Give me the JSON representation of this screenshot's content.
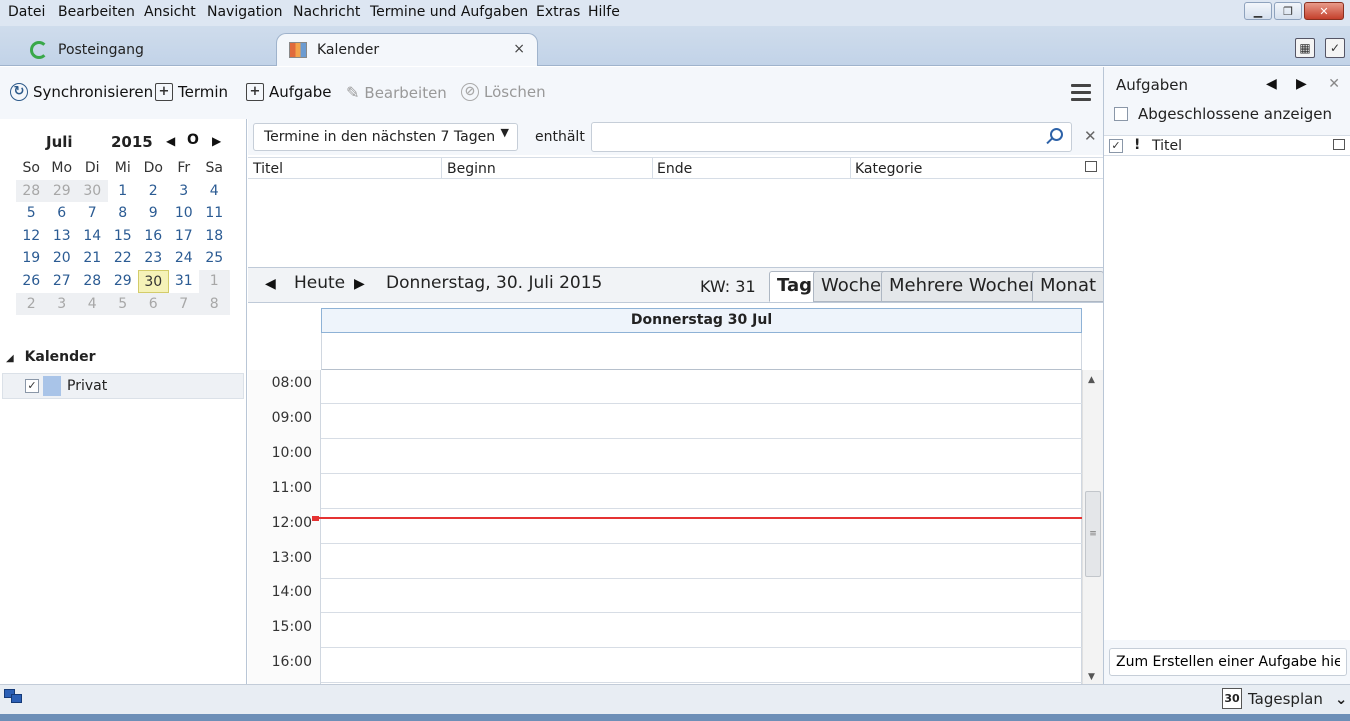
{
  "menu": [
    "Datei",
    "Bearbeiten",
    "Ansicht",
    "Navigation",
    "Nachricht",
    "Termine und Aufgaben",
    "Extras",
    "Hilfe"
  ],
  "tabs": {
    "inbox": "Posteingang",
    "calendar": "Kalender",
    "close": "×"
  },
  "toolbar": {
    "sync": "Synchronisieren",
    "event": "Termin",
    "task": "Aufgabe",
    "edit": "Bearbeiten",
    "delete": "Löschen"
  },
  "minical": {
    "month": "Juli",
    "year": "2015",
    "dow": [
      "So",
      "Mo",
      "Di",
      "Mi",
      "Do",
      "Fr",
      "Sa"
    ],
    "weeks": [
      [
        "28",
        "29",
        "30",
        "1",
        "2",
        "3",
        "4"
      ],
      [
        "5",
        "6",
        "7",
        "8",
        "9",
        "10",
        "11"
      ],
      [
        "12",
        "13",
        "14",
        "15",
        "16",
        "17",
        "18"
      ],
      [
        "19",
        "20",
        "21",
        "22",
        "23",
        "24",
        "25"
      ],
      [
        "26",
        "27",
        "28",
        "29",
        "30",
        "31",
        "1"
      ],
      [
        "2",
        "3",
        "4",
        "5",
        "6",
        "7",
        "8"
      ]
    ],
    "today": "30"
  },
  "calendars": {
    "title": "Kalender",
    "items": [
      {
        "name": "Privat",
        "color": "#a9c4e8",
        "checked": true
      }
    ]
  },
  "filter": {
    "selected": "Termine in den nächsten 7 Tagen",
    "contains": "enthält",
    "search_value": ""
  },
  "list": {
    "columns": [
      "Titel",
      "Beginn",
      "Ende",
      "Kategorie"
    ]
  },
  "nav": {
    "today": "Heute",
    "date": "Donnerstag, 30. Juli 2015",
    "week": "KW: 31",
    "views": [
      "Tag",
      "Woche",
      "Mehrere Wochen",
      "Monat"
    ],
    "active_view": "Tag"
  },
  "day": {
    "header": "Donnerstag 30 Jul",
    "times": [
      "08:00",
      "09:00",
      "10:00",
      "11:00",
      "12:00",
      "13:00",
      "14:00",
      "15:00",
      "16:00"
    ]
  },
  "tasks": {
    "title": "Aufgaben",
    "show_completed": "Abgeschlossene anzeigen",
    "column_title": "Titel",
    "new_task": "Zum Erstellen einer Aufgabe hier kl"
  },
  "status": {
    "view": "Tagesplan",
    "icon_day": "30"
  }
}
